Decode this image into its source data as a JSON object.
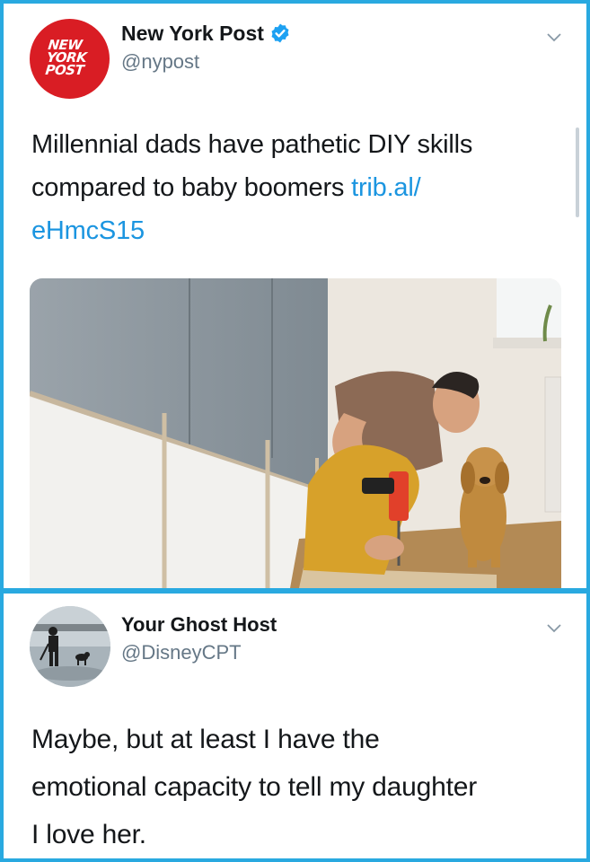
{
  "tweets": [
    {
      "display_name": "New York Post",
      "handle": "@nypost",
      "verified": true,
      "avatar_icon": "new-york-post-logo-icon",
      "avatar_lines": [
        "NEW",
        "YORK",
        "POST"
      ],
      "text_lines": [
        {
          "text": "Millennial dads have pathetic DIY skills",
          "link": ""
        },
        {
          "text": "compared to baby boomers ",
          "link": "trib.al/"
        },
        {
          "text": "",
          "link": "eHmcS15"
        }
      ],
      "media_icon": "photo-man-drilling-with-dog"
    },
    {
      "display_name": "Your Ghost Host",
      "handle": "@DisneyCPT",
      "verified": false,
      "avatar_icon": "person-walking-dog-photo-icon",
      "text_lines": [
        {
          "text": "Maybe, but at least I have the"
        },
        {
          "text": "emotional capacity to tell my daughter"
        },
        {
          "text": "I love her."
        }
      ]
    }
  ],
  "colors": {
    "frame": "#29a9e0",
    "link": "#1b95e0",
    "verified": "#1da1f2",
    "nyp_red": "#d91d24",
    "handle_gray": "#657786"
  }
}
